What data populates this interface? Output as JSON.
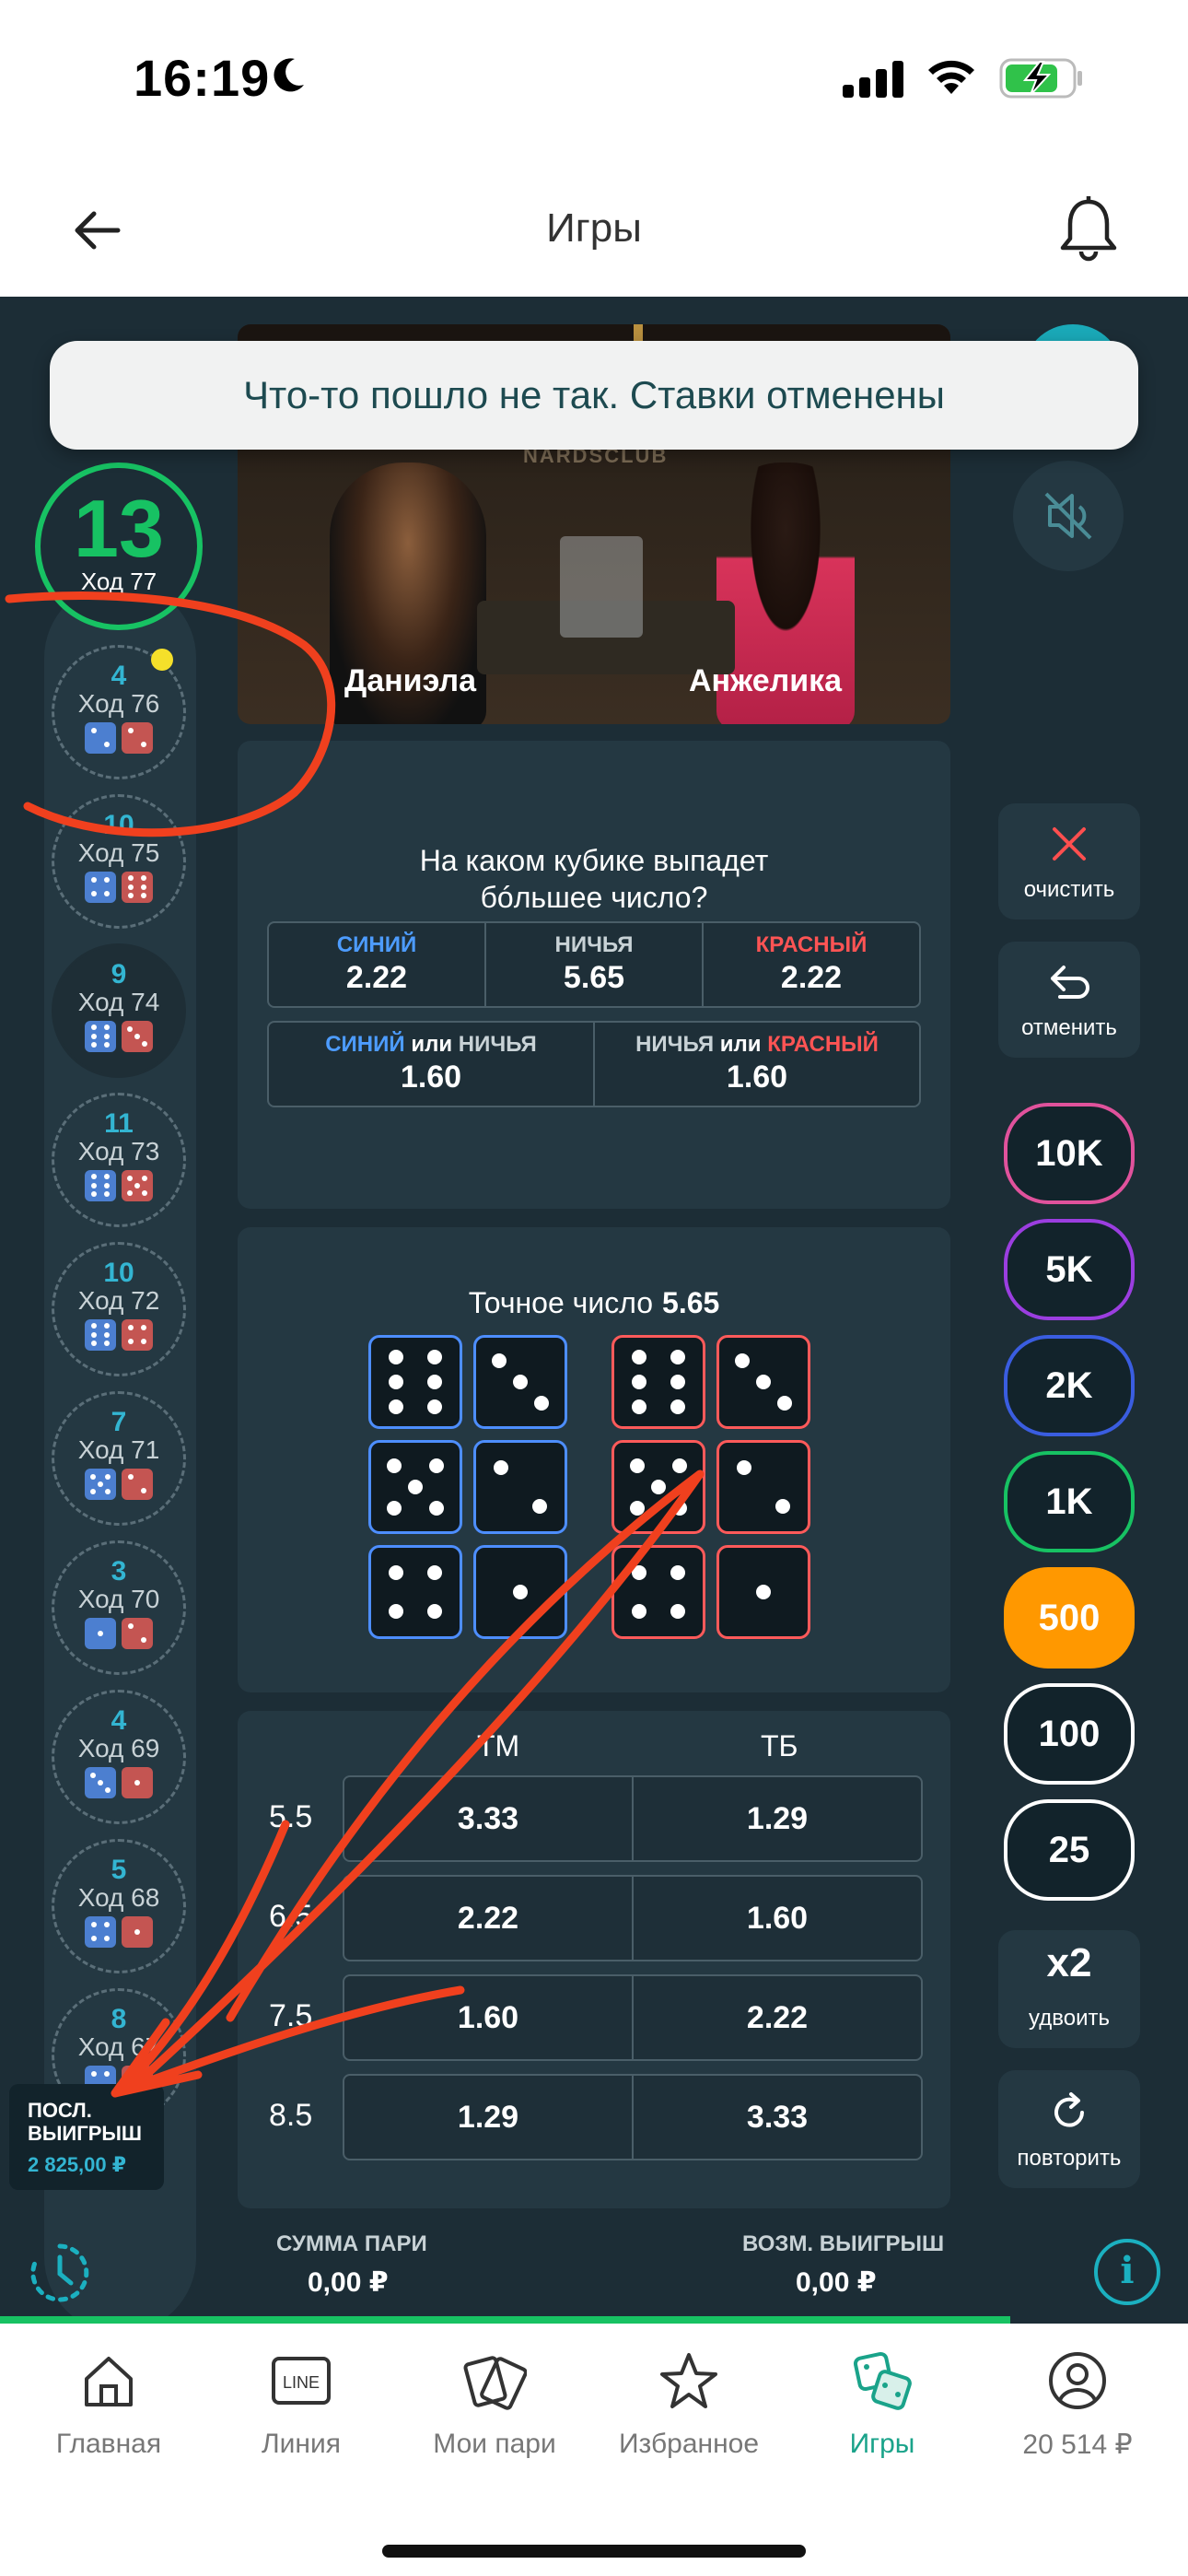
{
  "status_bar": {
    "time": "16:19"
  },
  "nav": {
    "title": "Игры"
  },
  "toast": {
    "message": "Что-то пошло не так. Ставки отменены"
  },
  "current_round": {
    "number": "13",
    "label": "Ход 77"
  },
  "history": [
    {
      "sum": "4",
      "label": "Ход 76",
      "blue": 2,
      "red": 2
    },
    {
      "sum": "10",
      "label": "Ход 75",
      "blue": 4,
      "red": 6
    },
    {
      "sum": "9",
      "label": "Ход 74",
      "blue": 6,
      "red": 3
    },
    {
      "sum": "11",
      "label": "Ход 73",
      "blue": 6,
      "red": 5
    },
    {
      "sum": "10",
      "label": "Ход 72",
      "blue": 6,
      "red": 4
    },
    {
      "sum": "7",
      "label": "Ход 71",
      "blue": 5,
      "red": 2
    },
    {
      "sum": "3",
      "label": "Ход 70",
      "blue": 1,
      "red": 2
    },
    {
      "sum": "4",
      "label": "Ход 69",
      "blue": 3,
      "red": 1
    },
    {
      "sum": "5",
      "label": "Ход 68",
      "blue": 4,
      "red": 1
    },
    {
      "sum": "8",
      "label": "Ход 67",
      "blue": 4,
      "red": 4
    }
  ],
  "last_win": {
    "title": "ПОСЛ. ВЫИГРЫШ",
    "value": "2 825,00 ₽"
  },
  "video": {
    "sign": "NARDSCLUB",
    "player_left": "Даниэла",
    "player_right": "Анжелика"
  },
  "bigger_number": {
    "question_line1": "На каком кубике выпадет",
    "question_line2": "бóльшее число?",
    "blue_label": "СИНИЙ",
    "blue_odd": "2.22",
    "draw_label": "НИЧЬЯ",
    "draw_odd": "5.65",
    "red_label": "КРАСНЫЙ",
    "red_odd": "2.22",
    "combo_or": "или",
    "blue_or_draw_odd": "1.60",
    "draw_or_red_odd": "1.60"
  },
  "exact": {
    "title": "Точное число",
    "odd": "5.65"
  },
  "totals": {
    "col_under": "ТМ",
    "col_over": "ТБ",
    "rows": [
      {
        "line": "5.5",
        "under": "3.33",
        "over": "1.29"
      },
      {
        "line": "6.5",
        "under": "2.22",
        "over": "1.60"
      },
      {
        "line": "7.5",
        "under": "1.60",
        "over": "2.22"
      },
      {
        "line": "8.5",
        "under": "1.29",
        "over": "3.33"
      }
    ]
  },
  "controls": {
    "clear_label": "очистить",
    "undo_label": "отменить",
    "chips": [
      {
        "label": "10K",
        "color": "#e0529c"
      },
      {
        "label": "5K",
        "color": "#9b3ee0"
      },
      {
        "label": "2K",
        "color": "#3a5de0"
      },
      {
        "label": "1K",
        "color": "#17c263"
      },
      {
        "label": "500",
        "color": "#ff9800",
        "selected": true
      },
      {
        "label": "100",
        "color": "#ffffff"
      },
      {
        "label": "25",
        "color": "#ffffff"
      }
    ],
    "double_main": "x2",
    "double_label": "удвоить",
    "repeat_label": "повторить"
  },
  "summary": {
    "bet_label": "СУММА ПАРИ",
    "bet_value": "0,00 ₽",
    "win_label": "ВОЗМ. ВЫИГРЫШ",
    "win_value": "0,00 ₽",
    "round_progress": 0.85
  },
  "tabs": [
    {
      "label": "Главная",
      "icon": "home-icon"
    },
    {
      "label": "Линия",
      "icon": "line-icon"
    },
    {
      "label": "Мои пари",
      "icon": "tickets-icon"
    },
    {
      "label": "Избранное",
      "icon": "star-icon"
    },
    {
      "label": "Игры",
      "icon": "dice-icon",
      "active": true
    },
    {
      "label": "20 514 ₽",
      "icon": "profile-icon"
    }
  ],
  "colors": {
    "accent_green": "#17c263",
    "accent_teal": "#1aa38a",
    "background": "#1c2d36",
    "panel": "#243842"
  }
}
